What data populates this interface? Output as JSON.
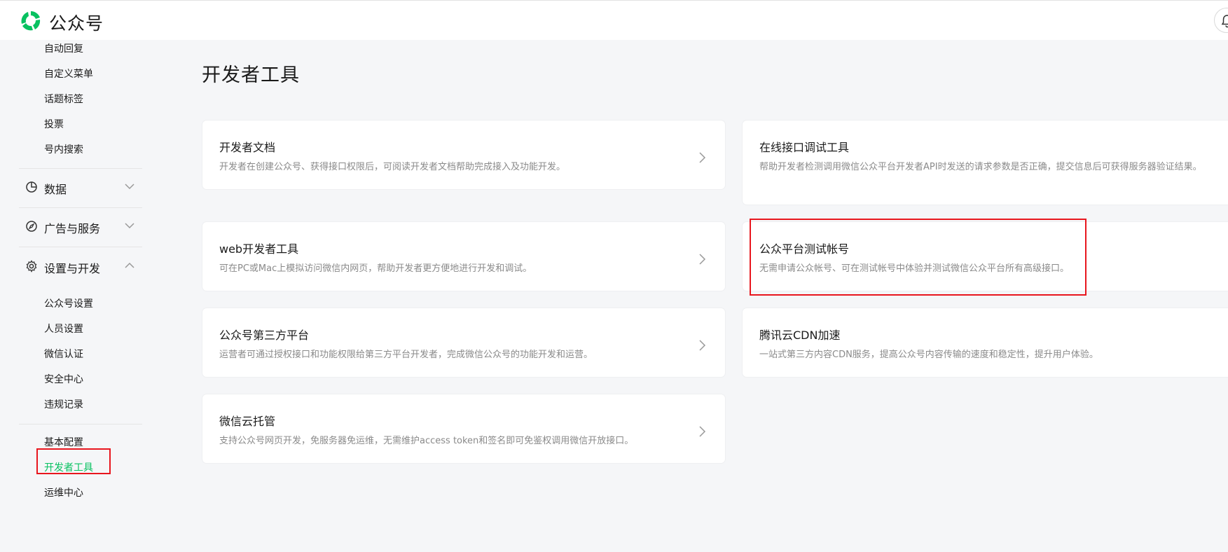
{
  "header": {
    "brand": "公众号"
  },
  "sidebar": {
    "top_items": [
      "自动回复",
      "自定义菜单",
      "话题标签",
      "投票",
      "号内搜索"
    ],
    "groups": [
      {
        "label": "数据",
        "icon": "chart-pie-icon",
        "expanded": false
      },
      {
        "label": "广告与服务",
        "icon": "compass-icon",
        "expanded": false
      },
      {
        "label": "设置与开发",
        "icon": "gear-icon",
        "expanded": true
      }
    ],
    "settings_items": [
      "公众号设置",
      "人员设置",
      "微信认证",
      "安全中心",
      "违规记录"
    ],
    "dev_items": [
      "基本配置",
      "开发者工具",
      "运维中心"
    ],
    "active_item": "开发者工具"
  },
  "main": {
    "title": "开发者工具",
    "cards": [
      {
        "title": "开发者文档",
        "desc": "开发者在创建公众号、获得接口权限后，可阅读开发者文档帮助完成接入及功能开发。"
      },
      {
        "title": "在线接口调试工具",
        "desc": "帮助开发者检测调用微信公众平台开发者API时发送的请求参数是否正确，提交信息后可获得服务器验证结果。"
      },
      {
        "title": "web开发者工具",
        "desc": "可在PC或Mac上模拟访问微信内网页，帮助开发者更方便地进行开发和调试。"
      },
      {
        "title": "公众平台测试帐号",
        "desc": "无需申请公众帐号、可在测试帐号中体验并测试微信公众平台所有高级接口。"
      },
      {
        "title": "公众号第三方平台",
        "desc": "运营者可通过授权接口和功能权限给第三方平台开发者，完成微信公众号的功能开发和运营。"
      },
      {
        "title": "腾讯云CDN加速",
        "desc": "一站式第三方内容CDN服务，提高公众号内容传输的速度和稳定性，提升用户体验。"
      },
      {
        "title": "微信云托管",
        "desc": "支持公众号网页开发，免服务器免运维，无需维护access token和签名即可免鉴权调用微信开放接口。"
      }
    ]
  },
  "colors": {
    "accent": "#07c160",
    "highlight": "#e8161e",
    "background": "#f5f6f8"
  }
}
